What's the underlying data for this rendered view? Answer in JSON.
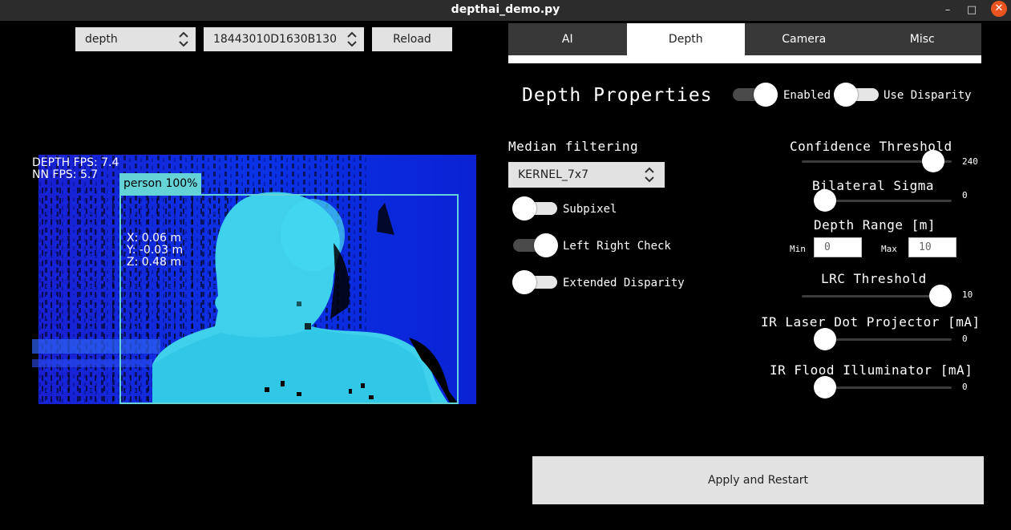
{
  "window": {
    "title": "depthai_demo.py",
    "minimize": "–",
    "maximize": "□",
    "close": "✕"
  },
  "toolbar": {
    "source_select": "depth",
    "device_select": "18443010D1630B130",
    "reload_label": "Reload"
  },
  "preview": {
    "depth_fps": "DEPTH FPS: 7.4",
    "nn_fps": "NN FPS:  5.7",
    "detection_label": "person 100%",
    "coord_x": "X: 0.06 m",
    "coord_y": "Y: -0.03 m",
    "coord_z": "Z: 0.48 m"
  },
  "tabs": [
    {
      "label": "AI",
      "active": false
    },
    {
      "label": "Depth",
      "active": true
    },
    {
      "label": "Camera",
      "active": false
    },
    {
      "label": "Misc",
      "active": false
    }
  ],
  "depth": {
    "title": "Depth Properties",
    "enabled": {
      "label": "Enabled",
      "on": true
    },
    "use_disparity": {
      "label": "Use Disparity",
      "on": false
    },
    "median_label": "Median filtering",
    "median_value": "KERNEL_7x7",
    "subpixel": {
      "label": "Subpixel",
      "on": false
    },
    "lr_check": {
      "label": "Left Right Check",
      "on": true
    },
    "extended": {
      "label": "Extended Disparity",
      "on": false
    },
    "confidence": {
      "label": "Confidence Threshold",
      "value": "240",
      "min": 0,
      "max": 255
    },
    "bilateral": {
      "label": "Bilateral Sigma",
      "value": "0",
      "min": 0,
      "max": 250
    },
    "range": {
      "label": "Depth Range [m]",
      "min_label": "Min",
      "max_label": "Max",
      "min_value": "0",
      "max_value": "10"
    },
    "lrc": {
      "label": "LRC Threshold",
      "value": "10",
      "min": 0,
      "max": 10
    },
    "laser": {
      "label": "IR Laser Dot Projector [mA]",
      "value": "0",
      "min": 0,
      "max": 1200
    },
    "flood": {
      "label": "IR Flood Illuminator [mA]",
      "value": "0",
      "min": 0,
      "max": 1500
    }
  },
  "apply_label": "Apply and Restart",
  "colors": {
    "background": "#000000",
    "depth_far": "#0a24d8",
    "depth_near": "#3fd6f0",
    "detection_box": "#64d2d6"
  }
}
